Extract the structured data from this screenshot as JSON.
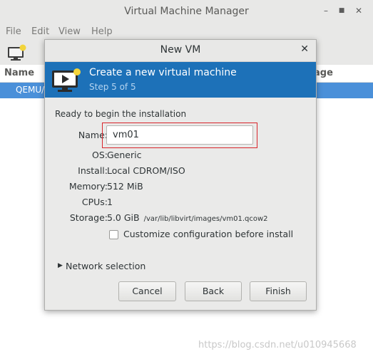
{
  "main_window": {
    "title": "Virtual Machine Manager",
    "menu": [
      "File",
      "Edit",
      "View",
      "Help"
    ],
    "columns": {
      "name": "Name",
      "usage": "age"
    },
    "rows": [
      {
        "label": "QEMU/K"
      }
    ]
  },
  "dialog": {
    "title": "New VM",
    "banner": {
      "title": "Create a new virtual machine",
      "step": "Step 5 of 5"
    },
    "ready_text": "Ready to begin the installation",
    "fields": {
      "name_label": "Name:",
      "name_value": "vm01",
      "os_label": "OS:",
      "os_value": "Generic",
      "install_label": "Install:",
      "install_value": "Local CDROM/ISO",
      "memory_label": "Memory:",
      "memory_value": "512 MiB",
      "cpus_label": "CPUs:",
      "cpus_value": "1",
      "storage_label": "Storage:",
      "storage_value": "5.0 GiB",
      "storage_path": "/var/lib/libvirt/images/vm01.qcow2"
    },
    "customize_label": "Customize configuration before install",
    "customize_checked": false,
    "network_label": "Network selection",
    "buttons": {
      "cancel": "Cancel",
      "back": "Back",
      "finish": "Finish"
    }
  },
  "watermark": "https://blog.csdn.net/u010945668",
  "colors": {
    "banner": "#1d71b8",
    "selection": "#4a90d9",
    "highlight_border": "#d9252b"
  }
}
